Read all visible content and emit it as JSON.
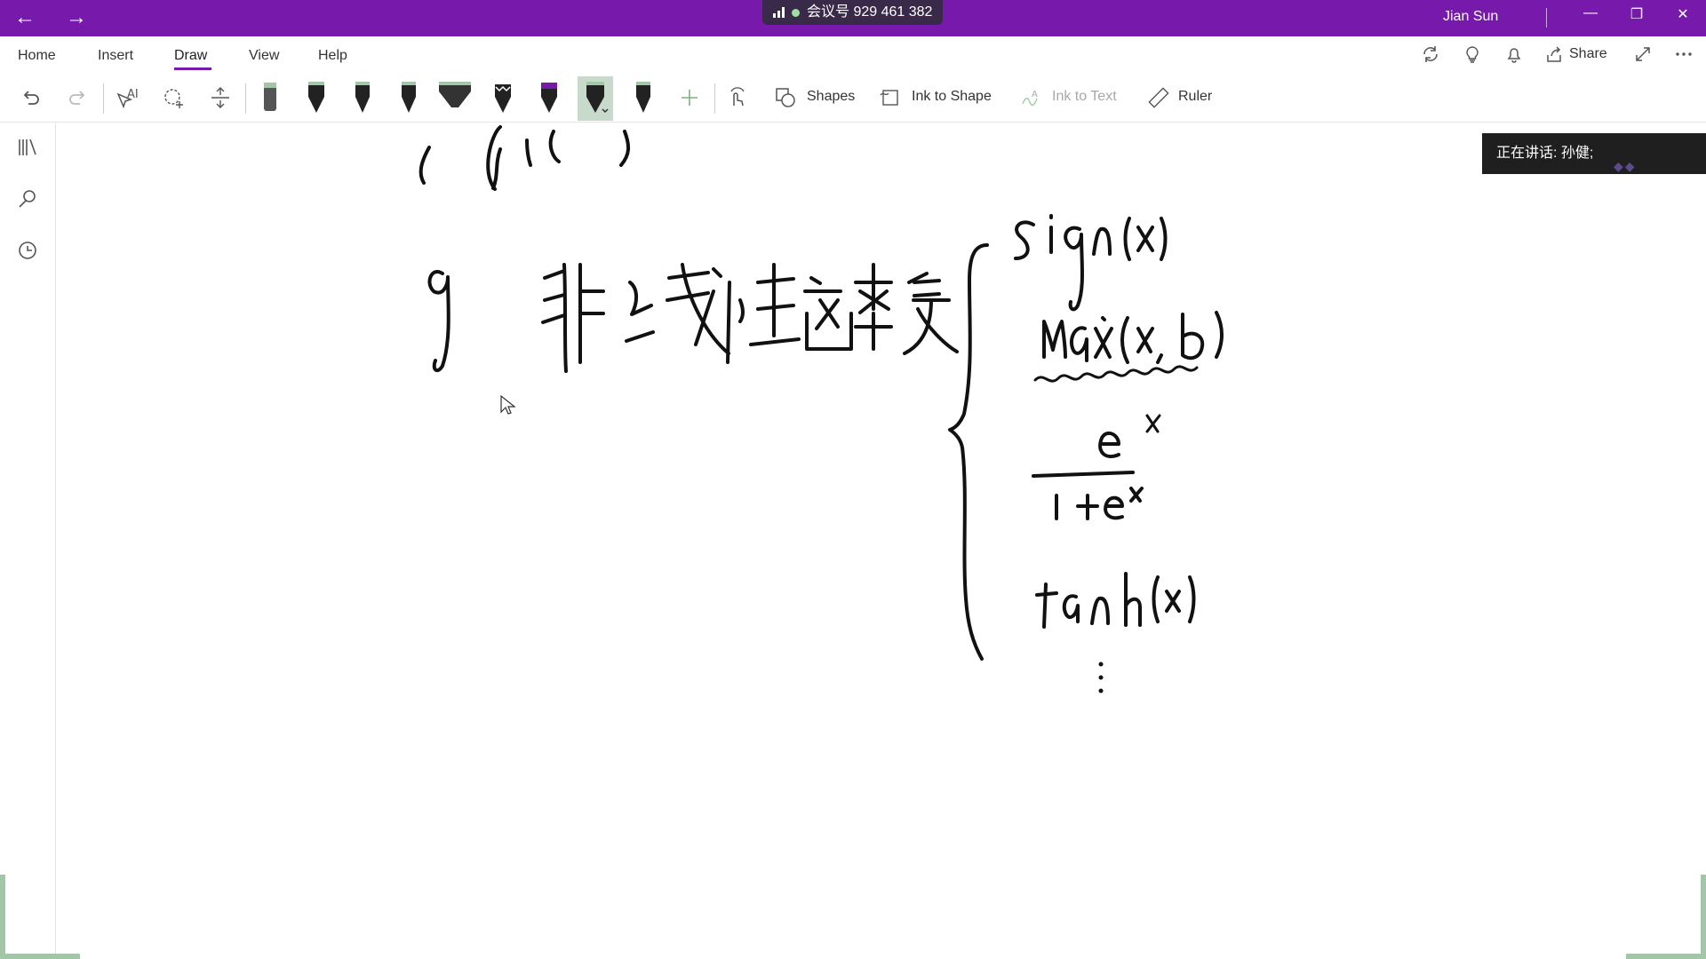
{
  "titlebar": {
    "back_glyph": "←",
    "forward_glyph": "→",
    "meeting_label": "会议号 929 461 382",
    "user_name": "Jian Sun",
    "minimize_glyph": "—",
    "restore_glyph": "❐",
    "close_glyph": "✕",
    "accent": "#7719aa"
  },
  "ribbon": {
    "tabs": [
      "Home",
      "Insert",
      "Draw",
      "View",
      "Help"
    ],
    "active_tab": "Draw",
    "share_label": "Share"
  },
  "toolbar": {
    "shapes_label": "Shapes",
    "ink_to_shape_label": "Ink to Shape",
    "ink_to_text_label": "Ink to Text",
    "ruler_label": "Ruler",
    "pens": [
      {
        "name": "pen-1",
        "color": "#555555"
      },
      {
        "name": "pen-2",
        "color": "#222222"
      },
      {
        "name": "pen-3",
        "color": "#222222"
      },
      {
        "name": "pen-4",
        "color": "#222222"
      },
      {
        "name": "highlighter-1",
        "color": "#333333"
      },
      {
        "name": "pen-5",
        "color": "#222222"
      },
      {
        "name": "pen-6",
        "color": "#7719aa"
      },
      {
        "name": "pen-7",
        "color": "#222222"
      },
      {
        "name": "pen-8",
        "color": "#222222"
      }
    ],
    "selected_pen": "pen-7",
    "selected_pen_bg": "#c7dacb"
  },
  "overlay": {
    "speaking_label": "正在讲话: 孙健;"
  },
  "ink": {
    "lhs_label": "g 非线性函数 =",
    "cases": [
      "sign(x)",
      "max(x, b)",
      "e^x / (1+e^x)",
      "tanh(x)",
      "⋮"
    ]
  }
}
